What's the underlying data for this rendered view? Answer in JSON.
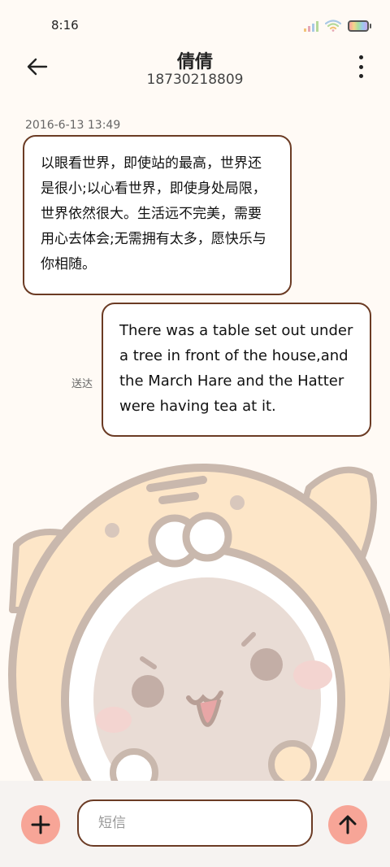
{
  "status_bar": {
    "time": "8:16"
  },
  "header": {
    "contact_name": "倩倩",
    "contact_number": "18730218809"
  },
  "conversation": {
    "timestamp": "2016-6-13 13:49",
    "incoming_message": "以眼看世界，即使站的最高，世界还是很小;以心看世界，即使身处局限，世界依然很大。生活远不完美，需要用心去体会;无需拥有太多，愿快乐与你相随。",
    "outgoing_message": "There was a table set out under a tree in front of the house,and the March Hare and the Hatter were having tea at it.",
    "delivery_status": "送达"
  },
  "composer": {
    "placeholder": "短信"
  },
  "colors": {
    "accent": "#f7a597",
    "bubble_border": "#6b3b24"
  }
}
